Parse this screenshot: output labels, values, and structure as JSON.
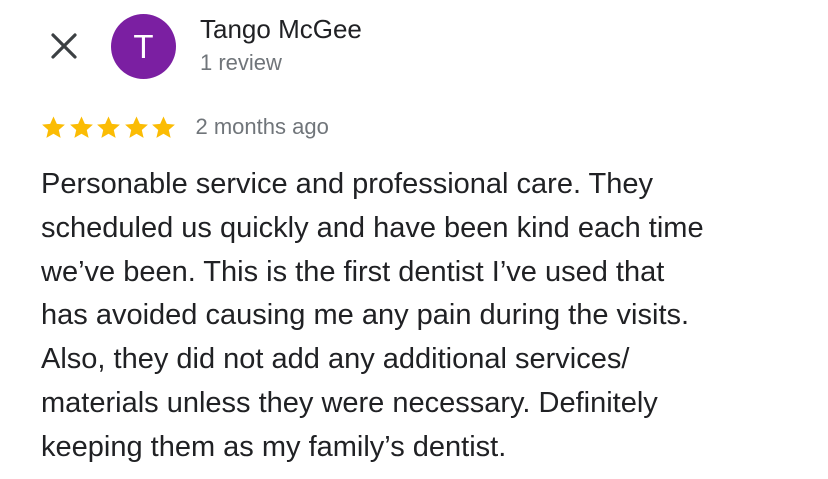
{
  "header": {
    "close_icon": "close-icon",
    "avatar_letter": "T",
    "avatar_color": "#7b1fa2",
    "reviewer_name": "Tango McGee",
    "review_count": "1 review"
  },
  "rating": {
    "stars": 5,
    "max_stars": 5,
    "star_color": "#fbbc04",
    "star_icon": "star-icon",
    "date": "2 months ago"
  },
  "review": {
    "lines": [
      "Personable service and professional care. They",
      "scheduled us quickly and have been kind each time",
      "we’ve been. This is the first dentist I’ve used that",
      "has avoided causing me any pain during the visits.",
      "Also, they did not add any additional services/",
      "materials unless they were necessary. Definitely",
      "keeping them as my family’s dentist."
    ]
  }
}
